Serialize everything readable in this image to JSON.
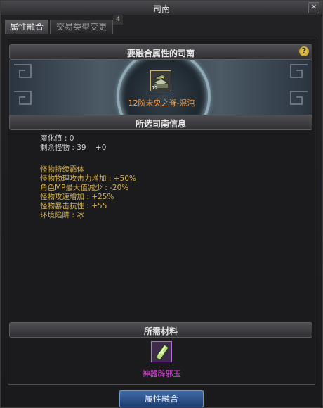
{
  "window": {
    "title": "司南",
    "close": "✕"
  },
  "tabs": {
    "active": "属性融合",
    "inactive": "交易类型变更",
    "badge": "4"
  },
  "fusion_section": {
    "header": "要融合属性的司南",
    "help": "?",
    "item": {
      "level": "12",
      "name": "12阶未央之脊-混沌"
    }
  },
  "info_section": {
    "header": "所选司南信息",
    "lines": [
      "魔化值 : 0",
      "剩余怪物 : 39    +0"
    ],
    "effects": [
      "怪物持续霸体",
      "怪物物理攻击力增加 : +50%",
      "角色MP最大值减少 : -20%",
      "怪物攻速增加 : +25%",
      "怪物暴击抗性 : +55",
      "环境陷阱 : 冰"
    ]
  },
  "material_section": {
    "header": "所需材料",
    "material": {
      "name": "神器辟邪玉"
    }
  },
  "action": {
    "fuse_label": "属性融合"
  },
  "colors": {
    "effect_text": "#d7b247",
    "item_name": "#ff9d3c",
    "material_name": "#e040e0",
    "button": "#2f548c"
  }
}
